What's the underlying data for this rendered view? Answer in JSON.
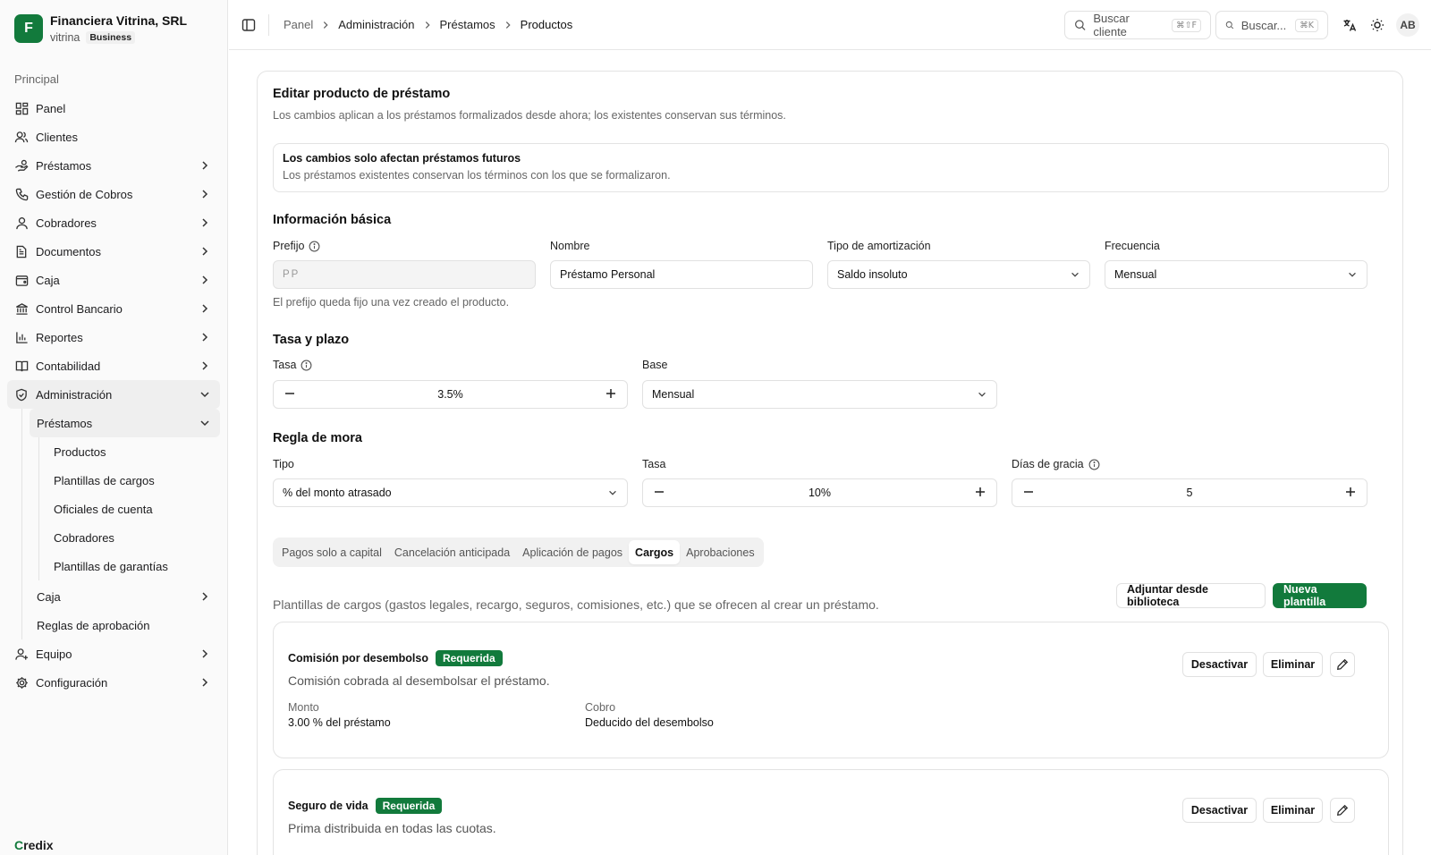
{
  "org": {
    "initial": "F",
    "name": "Financiera Vitrina, SRL",
    "slug": "vitrina",
    "plan": "Business"
  },
  "sidebar": {
    "section": "Principal",
    "items": [
      {
        "label": "Panel",
        "icon": "dashboard-icon"
      },
      {
        "label": "Clientes",
        "icon": "users-icon"
      },
      {
        "label": "Préstamos",
        "icon": "hand-coins-icon"
      },
      {
        "label": "Gestión de Cobros",
        "icon": "phone-icon"
      },
      {
        "label": "Cobradores",
        "icon": "user-icon"
      },
      {
        "label": "Documentos",
        "icon": "document-icon"
      },
      {
        "label": "Caja",
        "icon": "wallet-icon"
      },
      {
        "label": "Control Bancario",
        "icon": "bank-icon"
      },
      {
        "label": "Reportes",
        "icon": "bar-chart-icon"
      },
      {
        "label": "Contabilidad",
        "icon": "book-icon"
      },
      {
        "label": "Administración",
        "icon": "shield-icon"
      },
      {
        "label": "Equipo",
        "icon": "team-icon"
      },
      {
        "label": "Configuración",
        "icon": "gear-icon"
      }
    ],
    "admin_sub": {
      "prestamos": "Préstamos",
      "prestamos_children": [
        "Productos",
        "Plantillas de cargos",
        "Oficiales de cuenta",
        "Cobradores",
        "Plantillas de garantías"
      ],
      "caja": "Caja",
      "reglas": "Reglas de aprobación"
    },
    "brand": {
      "c": "C",
      "rest": "redix"
    }
  },
  "header": {
    "breadcrumbs": [
      "Panel",
      "Administración",
      "Préstamos",
      "Productos"
    ],
    "search_client": {
      "label": "Buscar cliente",
      "shortcut": "⌘⇧F"
    },
    "search_global": {
      "label": "Buscar...",
      "shortcut": "⌘K"
    },
    "avatar": "AB"
  },
  "form": {
    "title": "Editar producto de préstamo",
    "description": "Los cambios aplican a los préstamos formalizados desde ahora; los existentes conservan sus términos.",
    "alert": {
      "title": "Los cambios solo afectan préstamos futuros",
      "description": "Los préstamos existentes conservan los términos con los que se formalizaron."
    },
    "basic": {
      "title": "Información básica",
      "prefix_label": "Prefijo",
      "prefix_value": "PP",
      "prefix_help": "El prefijo queda fijo una vez creado el producto.",
      "name_label": "Nombre",
      "name_value": "Préstamo Personal",
      "amort_label": "Tipo de amortización",
      "amort_value": "Saldo insoluto",
      "freq_label": "Frecuencia",
      "freq_value": "Mensual"
    },
    "rate": {
      "title": "Tasa y plazo",
      "rate_label": "Tasa",
      "rate_value": "3.5%",
      "base_label": "Base",
      "base_value": "Mensual"
    },
    "late": {
      "title": "Regla de mora",
      "type_label": "Tipo",
      "type_value": "% del monto atrasado",
      "rate_label": "Tasa",
      "rate_value": "10%",
      "grace_label": "Días de gracia",
      "grace_value": "5"
    },
    "tabs": [
      "Pagos solo a capital",
      "Cancelación anticipada",
      "Aplicación de pagos",
      "Cargos",
      "Aprobaciones"
    ],
    "active_tab": "Cargos",
    "charges": {
      "description": "Plantillas de cargos (gastos legales, recargo, seguros, comisiones, etc.) que se ofrecen al crear un préstamo.",
      "attach_label": "Adjuntar desde biblioteca",
      "new_label": "Nueva plantilla",
      "items": [
        {
          "name": "Comisión por desembolso",
          "badge": "Requerida",
          "description": "Comisión cobrada al desembolsar el préstamo.",
          "amount_label": "Monto",
          "amount_value": "3.00 % del préstamo",
          "collect_label": "Cobro",
          "collect_value": "Deducido del desembolso",
          "deactivate": "Desactivar",
          "delete": "Eliminar"
        },
        {
          "name": "Seguro de vida",
          "badge": "Requerida",
          "description": "Prima distribuida en todas las cuotas.",
          "deactivate": "Desactivar",
          "delete": "Eliminar"
        }
      ]
    }
  },
  "colors": {
    "accent": "#127a3c",
    "border": "#e3e3e3",
    "muted": "#666666"
  }
}
